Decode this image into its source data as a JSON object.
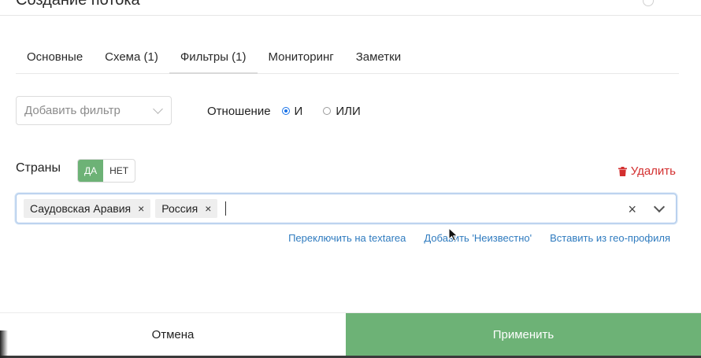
{
  "header": {
    "title": "Создание потока"
  },
  "tabs": [
    {
      "label": "Основные"
    },
    {
      "label": "Схема (1)"
    },
    {
      "label": "Фильтры (1)"
    },
    {
      "label": "Мониторинг"
    },
    {
      "label": "Заметки"
    }
  ],
  "active_tab": "Фильтры (1)",
  "filter_select": {
    "placeholder": "Добавить фильтр"
  },
  "relation": {
    "label": "Отношение",
    "options": [
      {
        "label": "И",
        "checked": true
      },
      {
        "label": "ИЛИ",
        "checked": false
      }
    ]
  },
  "countries": {
    "label": "Страны",
    "toggle": {
      "yes": "ДА",
      "no": "НЕТ",
      "selected": "ДА"
    },
    "delete_label": "Удалить",
    "tags": [
      {
        "label": "Саудовская Аравия"
      },
      {
        "label": "Россия"
      }
    ],
    "tag_remove": "×",
    "clear": "×"
  },
  "links": {
    "switch_textarea": "Переключить на textarea",
    "add_unknown": "Добавить 'Неизвестно'",
    "insert_geo": "Вставить из гео-профиля"
  },
  "footer": {
    "cancel": "Отмена",
    "apply": "Применить"
  },
  "colors": {
    "accent_green": "#6db276",
    "link_blue": "#2f7bbf",
    "danger_red": "#d32f2f",
    "radio_blue": "#1a73e8"
  },
  "icons": [
    "chevron-down-icon",
    "trash-icon",
    "close-icon",
    "mouse-cursor-icon"
  ]
}
